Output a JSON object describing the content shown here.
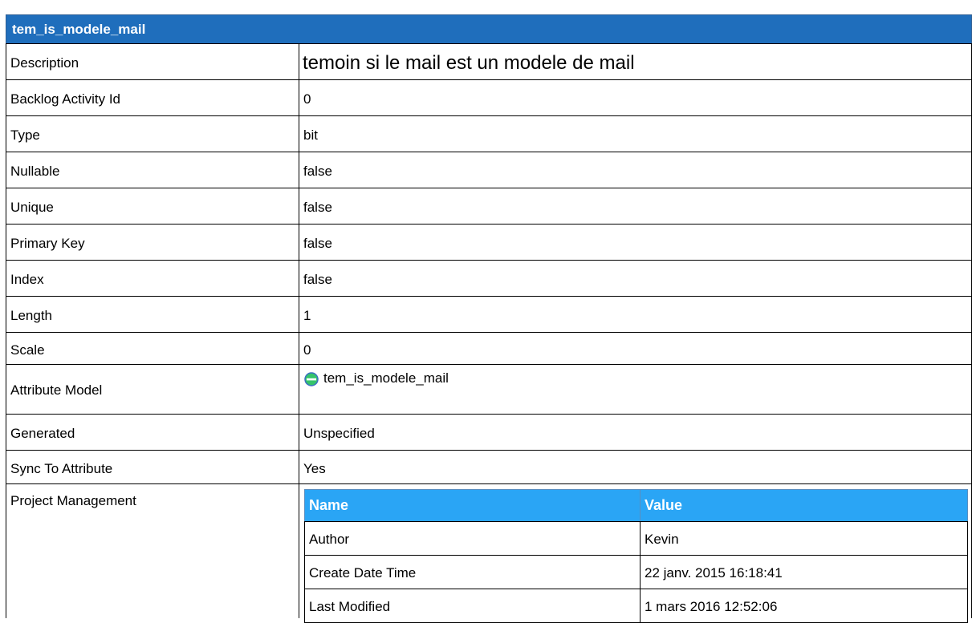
{
  "title": "tem_is_modele_mail",
  "rows": [
    {
      "label": "Description",
      "value": "temoin si le mail est un modele de mail"
    },
    {
      "label": "Backlog Activity Id",
      "value": "0"
    },
    {
      "label": "Type",
      "value": "bit"
    },
    {
      "label": "Nullable",
      "value": "false"
    },
    {
      "label": "Unique",
      "value": "false"
    },
    {
      "label": "Primary Key",
      "value": "false"
    },
    {
      "label": "Index",
      "value": "false"
    },
    {
      "label": "Length",
      "value": "1"
    },
    {
      "label": "Scale",
      "value": "0"
    },
    {
      "label": "Attribute Model",
      "value": "tem_is_modele_mail",
      "icon": "attribute-model-icon"
    },
    {
      "label": "Generated",
      "value": "Unspecified"
    },
    {
      "label": "Sync To Attribute",
      "value": "Yes"
    }
  ],
  "project_management": {
    "label": "Project Management",
    "headers": {
      "name": "Name",
      "value": "Value"
    },
    "rows": [
      {
        "name": "Author",
        "value": "Kevin"
      },
      {
        "name": "Create Date Time",
        "value": "22 janv. 2015 16:18:41"
      },
      {
        "name": "Last Modified",
        "value": "1 mars 2016 12:52:06"
      }
    ]
  },
  "colors": {
    "header_bg": "#1f6ebc",
    "subheader_bg": "#2aa5f5",
    "icon_fill": "#35c46a",
    "icon_ring": "#3a6fc0"
  }
}
